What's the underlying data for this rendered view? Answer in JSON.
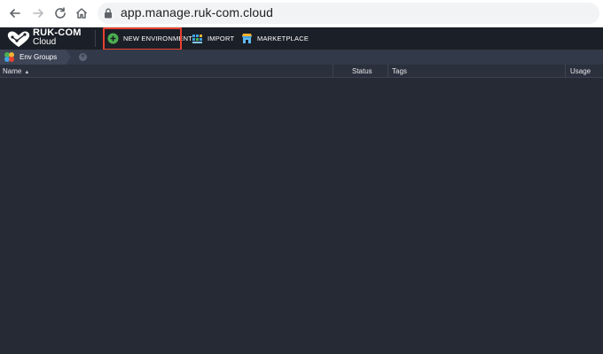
{
  "browser": {
    "url": "app.manage.ruk-com.cloud"
  },
  "brand": {
    "name": "RUK-COM",
    "sub": "Cloud"
  },
  "toolbar": {
    "new_environment": "NEW ENVIRONMENT",
    "import": "IMPORT",
    "marketplace": "MARKETPLACE"
  },
  "env_groups": {
    "label": "Env Groups"
  },
  "table": {
    "columns": {
      "name": "Name",
      "status": "Status",
      "tags": "Tags",
      "usage": "Usage"
    },
    "rows": []
  },
  "colors": {
    "highlight": "#e8412f",
    "toolbar_bg": "#1b1f27",
    "body_bg": "#252a35",
    "new_env_icon": "#4caf50"
  },
  "icons": {
    "back": "arrow-left-icon",
    "forward": "arrow-right-icon",
    "reload": "reload-icon",
    "home": "home-icon",
    "lock": "lock-icon",
    "new_environment": "plus-circle-icon",
    "import": "import-icon",
    "marketplace": "marketplace-icon",
    "env_groups": "env-groups-icon"
  }
}
